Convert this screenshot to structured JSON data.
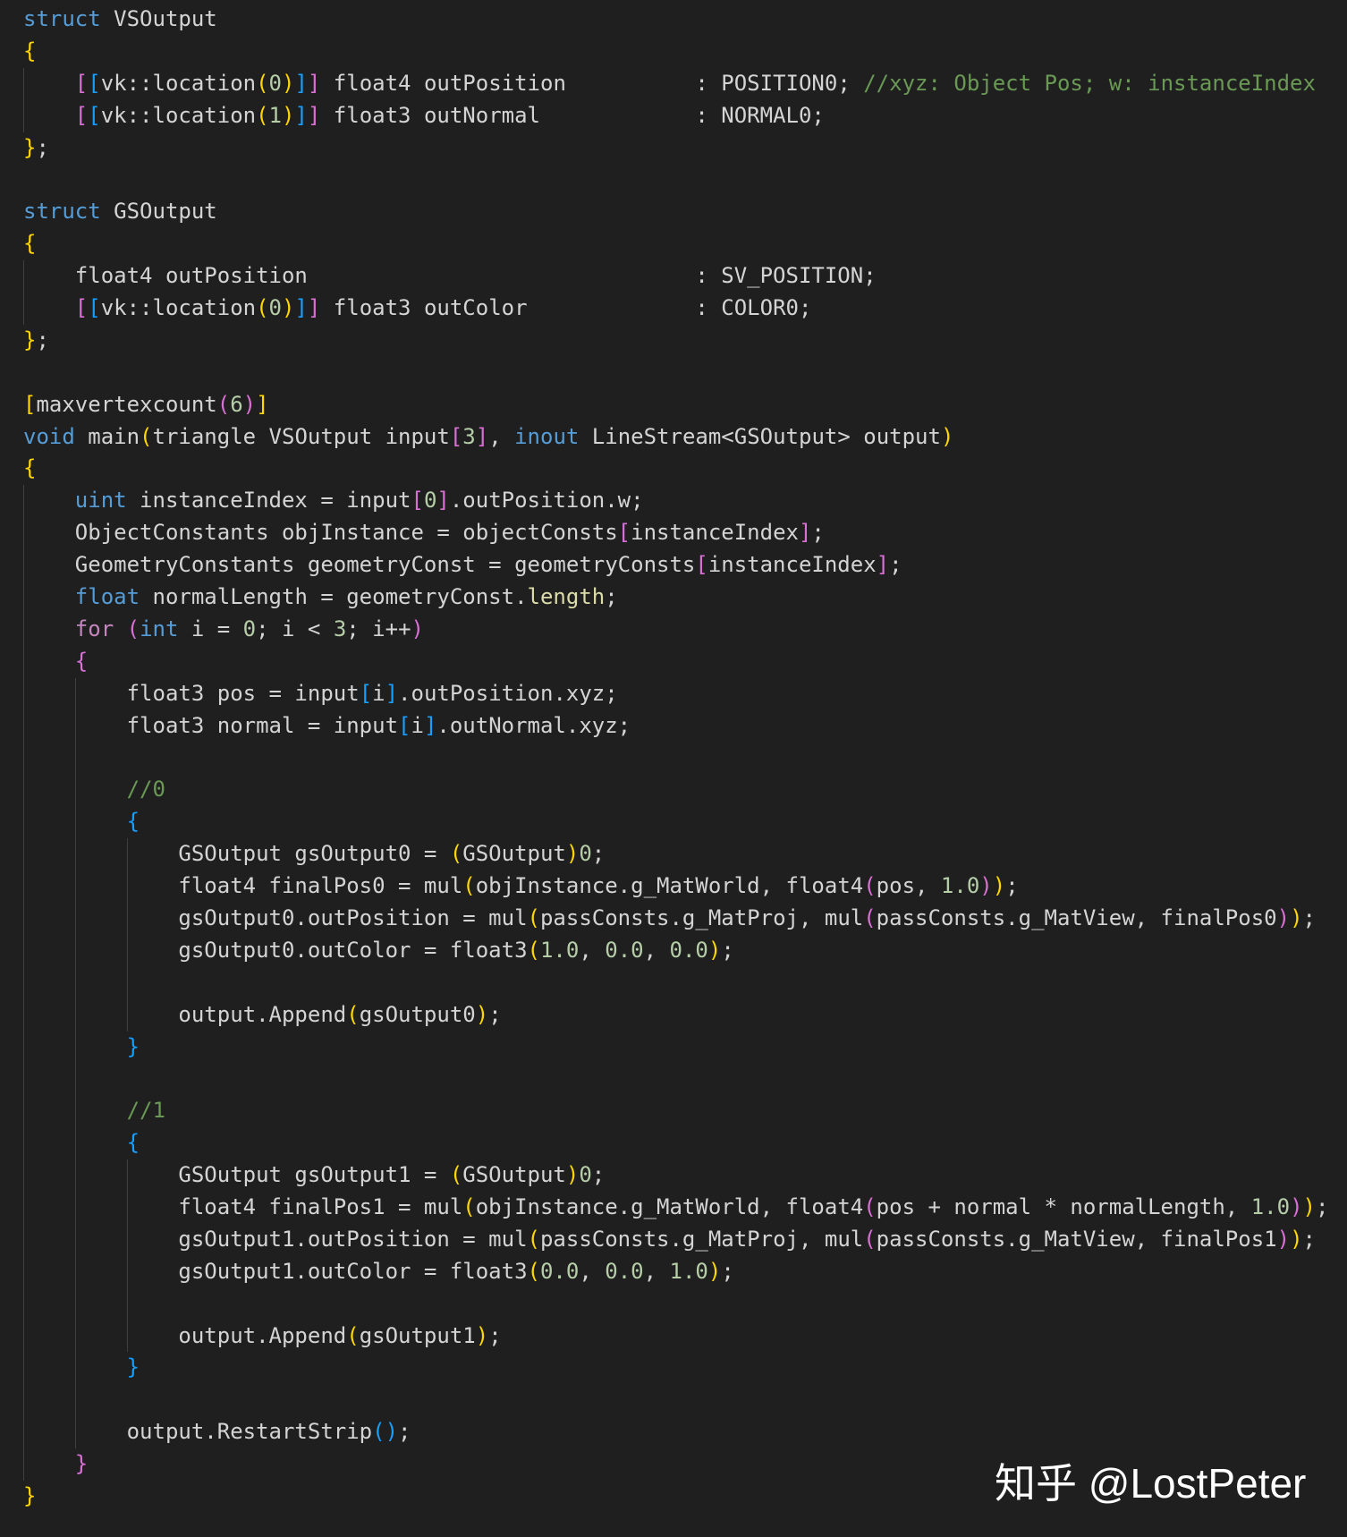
{
  "colors": {
    "background": "#1f1f1f",
    "text": "#d4d4d4",
    "keyword": "#569cd6",
    "control": "#c586c0",
    "number": "#b5cea8",
    "comment": "#6a9955",
    "bracket1": "#ffd700",
    "bracket2": "#da70d6",
    "bracket3": "#179fff"
  },
  "code": {
    "lines": [
      [
        [
          "struct",
          "k"
        ],
        [
          " VSOutput",
          "p"
        ]
      ],
      [
        [
          "{",
          "b1"
        ]
      ],
      [
        [
          "    ",
          "p"
        ],
        [
          "[",
          "b2"
        ],
        [
          "[",
          "b3"
        ],
        [
          "vk::location",
          "p"
        ],
        [
          "(",
          "b1"
        ],
        [
          "0",
          "n"
        ],
        [
          ")",
          "b1"
        ],
        [
          "]",
          "b3"
        ],
        [
          "]",
          "b2"
        ],
        [
          " float4 outPosition          : POSITION0; ",
          "p"
        ],
        [
          "//xyz: Object Pos; w: instanceIndex",
          "cm"
        ]
      ],
      [
        [
          "    ",
          "p"
        ],
        [
          "[",
          "b2"
        ],
        [
          "[",
          "b3"
        ],
        [
          "vk::location",
          "p"
        ],
        [
          "(",
          "b1"
        ],
        [
          "1",
          "n"
        ],
        [
          ")",
          "b1"
        ],
        [
          "]",
          "b3"
        ],
        [
          "]",
          "b2"
        ],
        [
          " float3 outNormal            : NORMAL0;",
          "p"
        ]
      ],
      [
        [
          "}",
          "b1"
        ],
        [
          ";",
          "p"
        ]
      ],
      [],
      [
        [
          "struct",
          "k"
        ],
        [
          " GSOutput",
          "p"
        ]
      ],
      [
        [
          "{",
          "b1"
        ]
      ],
      [
        [
          "    ",
          "p"
        ],
        [
          "float4 outPosition                              : SV_POSITION;",
          "p"
        ]
      ],
      [
        [
          "    ",
          "p"
        ],
        [
          "[",
          "b2"
        ],
        [
          "[",
          "b3"
        ],
        [
          "vk::location",
          "p"
        ],
        [
          "(",
          "b1"
        ],
        [
          "0",
          "n"
        ],
        [
          ")",
          "b1"
        ],
        [
          "]",
          "b3"
        ],
        [
          "]",
          "b2"
        ],
        [
          " float3 outColor             : COLOR0;",
          "p"
        ]
      ],
      [
        [
          "}",
          "b1"
        ],
        [
          ";",
          "p"
        ]
      ],
      [],
      [
        [
          "[",
          "b1"
        ],
        [
          "maxvertexcount",
          "p"
        ],
        [
          "(",
          "b2"
        ],
        [
          "6",
          "n"
        ],
        [
          ")",
          "b2"
        ],
        [
          "]",
          "b1"
        ]
      ],
      [
        [
          "void",
          "k"
        ],
        [
          " main",
          "p"
        ],
        [
          "(",
          "b1"
        ],
        [
          "triangle VSOutput input",
          "p"
        ],
        [
          "[",
          "b2"
        ],
        [
          "3",
          "n"
        ],
        [
          "]",
          "b2"
        ],
        [
          ", ",
          "p"
        ],
        [
          "inout",
          "k"
        ],
        [
          " LineStream<GSOutput> output",
          "p"
        ],
        [
          ")",
          "b1"
        ]
      ],
      [
        [
          "{",
          "b1"
        ]
      ],
      [
        [
          "    ",
          "p"
        ],
        [
          "uint",
          "k"
        ],
        [
          " instanceIndex = input",
          "p"
        ],
        [
          "[",
          "b2"
        ],
        [
          "0",
          "n"
        ],
        [
          "]",
          "b2"
        ],
        [
          ".outPosition.w;",
          "p"
        ]
      ],
      [
        [
          "    ",
          "p"
        ],
        [
          "ObjectConstants objInstance = objectConsts",
          "p"
        ],
        [
          "[",
          "b2"
        ],
        [
          "instanceIndex",
          "p"
        ],
        [
          "]",
          "b2"
        ],
        [
          ";",
          "p"
        ]
      ],
      [
        [
          "    ",
          "p"
        ],
        [
          "GeometryConstants geometryConst = geometryConsts",
          "p"
        ],
        [
          "[",
          "b2"
        ],
        [
          "instanceIndex",
          "p"
        ],
        [
          "]",
          "b2"
        ],
        [
          ";",
          "p"
        ]
      ],
      [
        [
          "    ",
          "p"
        ],
        [
          "float",
          "k"
        ],
        [
          " normalLength = geometryConst.",
          "p"
        ],
        [
          "length",
          "f"
        ],
        [
          ";",
          "p"
        ]
      ],
      [
        [
          "    ",
          "p"
        ],
        [
          "for",
          "c"
        ],
        [
          " ",
          "p"
        ],
        [
          "(",
          "b2"
        ],
        [
          "int",
          "k"
        ],
        [
          " i = ",
          "p"
        ],
        [
          "0",
          "n"
        ],
        [
          "; i < ",
          "p"
        ],
        [
          "3",
          "n"
        ],
        [
          "; i++",
          "p"
        ],
        [
          ")",
          "b2"
        ]
      ],
      [
        [
          "    ",
          "p"
        ],
        [
          "{",
          "b2"
        ]
      ],
      [
        [
          "        ",
          "p"
        ],
        [
          "float3 pos = input",
          "p"
        ],
        [
          "[",
          "b3"
        ],
        [
          "i",
          "p"
        ],
        [
          "]",
          "b3"
        ],
        [
          ".outPosition.xyz;",
          "p"
        ]
      ],
      [
        [
          "        ",
          "p"
        ],
        [
          "float3 normal = input",
          "p"
        ],
        [
          "[",
          "b3"
        ],
        [
          "i",
          "p"
        ],
        [
          "]",
          "b3"
        ],
        [
          ".outNormal.xyz;",
          "p"
        ]
      ],
      [
        [
          "        ",
          "p"
        ]
      ],
      [
        [
          "        ",
          "p"
        ],
        [
          "//0",
          "cm"
        ]
      ],
      [
        [
          "        ",
          "p"
        ],
        [
          "{",
          "b3"
        ]
      ],
      [
        [
          "            ",
          "p"
        ],
        [
          "GSOutput gsOutput0 = ",
          "p"
        ],
        [
          "(",
          "b1"
        ],
        [
          "GSOutput",
          "p"
        ],
        [
          ")",
          "b1"
        ],
        [
          "0",
          "n"
        ],
        [
          ";",
          "p"
        ]
      ],
      [
        [
          "            ",
          "p"
        ],
        [
          "float4 finalPos0 = mul",
          "p"
        ],
        [
          "(",
          "b1"
        ],
        [
          "objInstance.g_MatWorld, float4",
          "p"
        ],
        [
          "(",
          "b2"
        ],
        [
          "pos, ",
          "p"
        ],
        [
          "1.0",
          "n"
        ],
        [
          ")",
          "b2"
        ],
        [
          ")",
          "b1"
        ],
        [
          ";",
          "p"
        ]
      ],
      [
        [
          "            ",
          "p"
        ],
        [
          "gsOutput0.outPosition = mul",
          "p"
        ],
        [
          "(",
          "b1"
        ],
        [
          "passConsts.g_MatProj, mul",
          "p"
        ],
        [
          "(",
          "b2"
        ],
        [
          "passConsts.g_MatView, finalPos0",
          "p"
        ],
        [
          ")",
          "b2"
        ],
        [
          ")",
          "b1"
        ],
        [
          ";",
          "p"
        ]
      ],
      [
        [
          "            ",
          "p"
        ],
        [
          "gsOutput0.outColor = float3",
          "p"
        ],
        [
          "(",
          "b1"
        ],
        [
          "1.0",
          "n"
        ],
        [
          ", ",
          "p"
        ],
        [
          "0.0",
          "n"
        ],
        [
          ", ",
          "p"
        ],
        [
          "0.0",
          "n"
        ],
        [
          ")",
          "b1"
        ],
        [
          ";",
          "p"
        ]
      ],
      [
        [
          "            ",
          "p"
        ]
      ],
      [
        [
          "            ",
          "p"
        ],
        [
          "output.Append",
          "p"
        ],
        [
          "(",
          "b1"
        ],
        [
          "gsOutput0",
          "p"
        ],
        [
          ")",
          "b1"
        ],
        [
          ";",
          "p"
        ]
      ],
      [
        [
          "        ",
          "p"
        ],
        [
          "}",
          "b3"
        ]
      ],
      [
        [
          "        ",
          "p"
        ]
      ],
      [
        [
          "        ",
          "p"
        ],
        [
          "//1",
          "cm"
        ]
      ],
      [
        [
          "        ",
          "p"
        ],
        [
          "{",
          "b3"
        ]
      ],
      [
        [
          "            ",
          "p"
        ],
        [
          "GSOutput gsOutput1 = ",
          "p"
        ],
        [
          "(",
          "b1"
        ],
        [
          "GSOutput",
          "p"
        ],
        [
          ")",
          "b1"
        ],
        [
          "0",
          "n"
        ],
        [
          ";",
          "p"
        ]
      ],
      [
        [
          "            ",
          "p"
        ],
        [
          "float4 finalPos1 = mul",
          "p"
        ],
        [
          "(",
          "b1"
        ],
        [
          "objInstance.g_MatWorld, float4",
          "p"
        ],
        [
          "(",
          "b2"
        ],
        [
          "pos + normal * normalLength, ",
          "p"
        ],
        [
          "1.0",
          "n"
        ],
        [
          ")",
          "b2"
        ],
        [
          ")",
          "b1"
        ],
        [
          ";",
          "p"
        ]
      ],
      [
        [
          "            ",
          "p"
        ],
        [
          "gsOutput1.outPosition = mul",
          "p"
        ],
        [
          "(",
          "b1"
        ],
        [
          "passConsts.g_MatProj, mul",
          "p"
        ],
        [
          "(",
          "b2"
        ],
        [
          "passConsts.g_MatView, finalPos1",
          "p"
        ],
        [
          ")",
          "b2"
        ],
        [
          ")",
          "b1"
        ],
        [
          ";",
          "p"
        ]
      ],
      [
        [
          "            ",
          "p"
        ],
        [
          "gsOutput1.outColor = float3",
          "p"
        ],
        [
          "(",
          "b1"
        ],
        [
          "0.0",
          "n"
        ],
        [
          ", ",
          "p"
        ],
        [
          "0.0",
          "n"
        ],
        [
          ", ",
          "p"
        ],
        [
          "1.0",
          "n"
        ],
        [
          ")",
          "b1"
        ],
        [
          ";",
          "p"
        ]
      ],
      [
        [
          "            ",
          "p"
        ]
      ],
      [
        [
          "            ",
          "p"
        ],
        [
          "output.Append",
          "p"
        ],
        [
          "(",
          "b1"
        ],
        [
          "gsOutput1",
          "p"
        ],
        [
          ")",
          "b1"
        ],
        [
          ";",
          "p"
        ]
      ],
      [
        [
          "        ",
          "p"
        ],
        [
          "}",
          "b3"
        ]
      ],
      [
        [
          "        ",
          "p"
        ]
      ],
      [
        [
          "        ",
          "p"
        ],
        [
          "output.RestartStrip",
          "p"
        ],
        [
          "(",
          "b3"
        ],
        [
          ")",
          "b3"
        ],
        [
          ";",
          "p"
        ]
      ],
      [
        [
          "    ",
          "p"
        ],
        [
          "}",
          "b2"
        ]
      ],
      [
        [
          "}",
          "b1"
        ]
      ]
    ]
  },
  "watermark": "知乎 @LostPeter"
}
